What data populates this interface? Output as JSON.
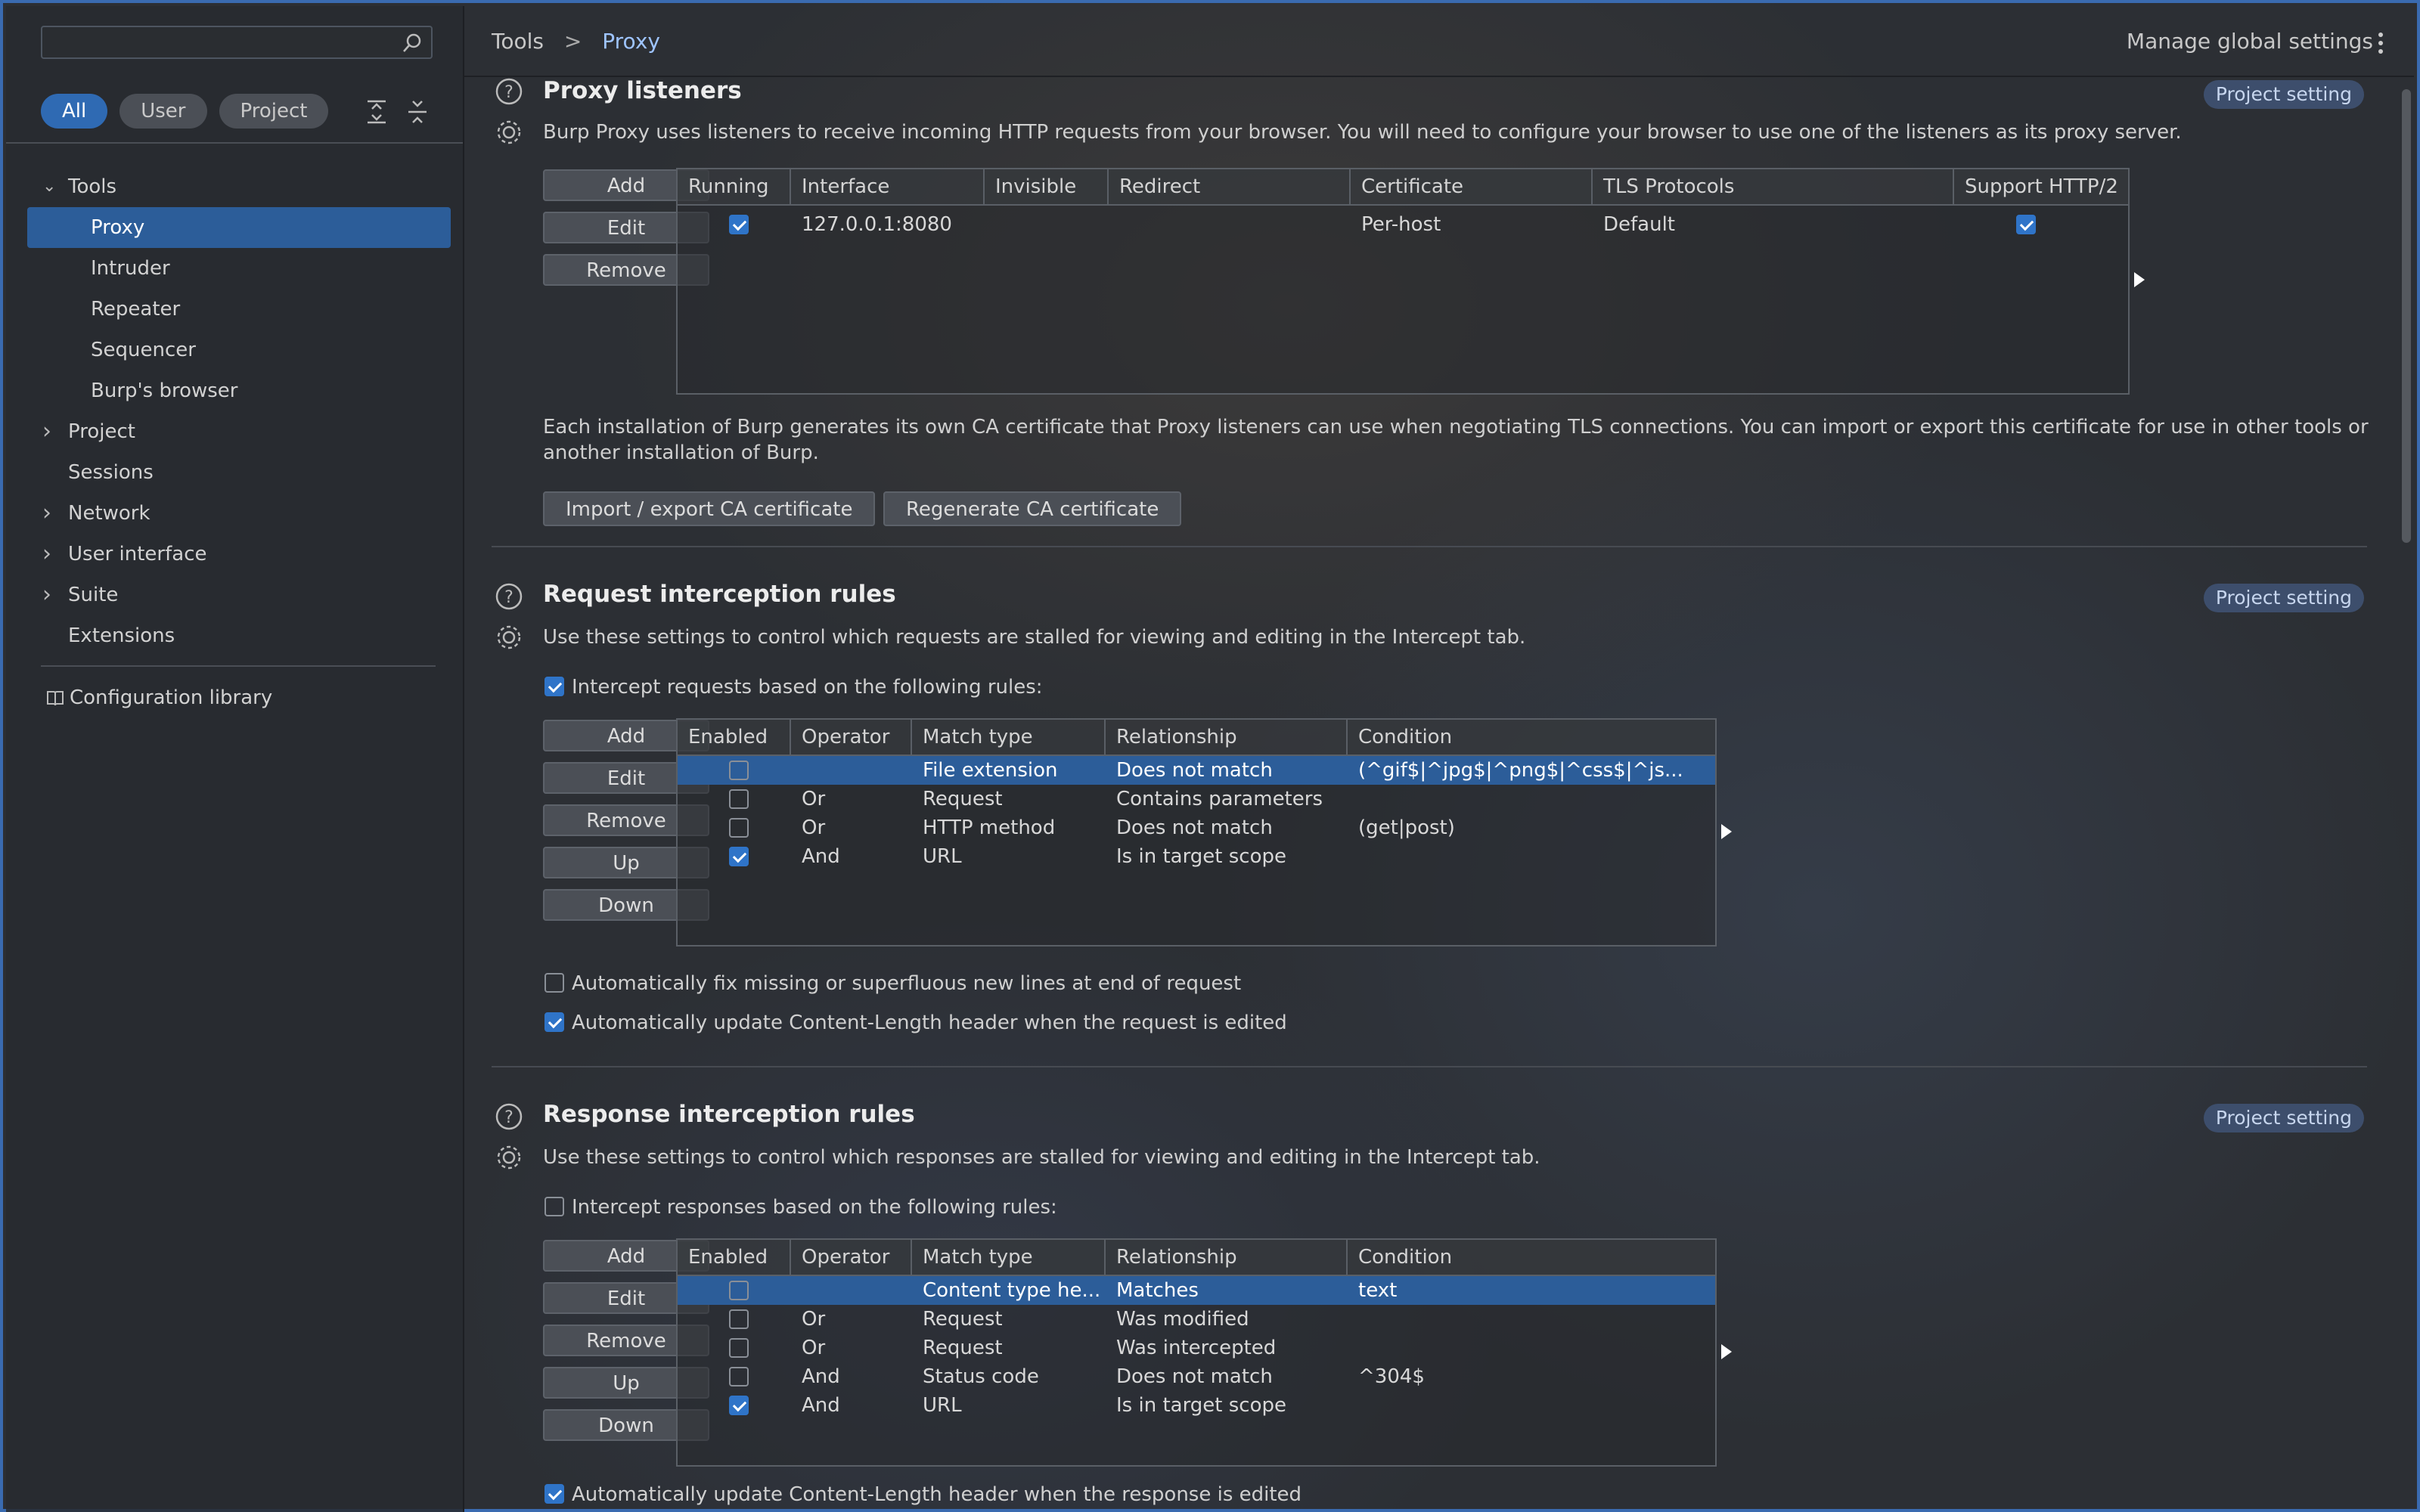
{
  "sidebar": {
    "search_placeholder": "",
    "filters": [
      "All",
      "User",
      "Project"
    ],
    "tree": [
      {
        "label": "Tools",
        "chevron": "v",
        "level": 0
      },
      {
        "label": "Proxy",
        "chevron": "",
        "level": 1,
        "selected": true
      },
      {
        "label": "Intruder",
        "chevron": "",
        "level": 1
      },
      {
        "label": "Repeater",
        "chevron": "",
        "level": 1
      },
      {
        "label": "Sequencer",
        "chevron": "",
        "level": 1
      },
      {
        "label": "Burp's browser",
        "chevron": "",
        "level": 1
      },
      {
        "label": "Project",
        "chevron": ">",
        "level": 0
      },
      {
        "label": "Sessions",
        "chevron": "",
        "level": 0
      },
      {
        "label": "Network",
        "chevron": ">",
        "level": 0
      },
      {
        "label": "User interface",
        "chevron": ">",
        "level": 0
      },
      {
        "label": "Suite",
        "chevron": ">",
        "level": 0
      },
      {
        "label": "Extensions",
        "chevron": "",
        "level": 0
      }
    ],
    "config_library": "Configuration library"
  },
  "header": {
    "breadcrumb_root": "Tools",
    "breadcrumb_sep": ">",
    "breadcrumb_current": "Proxy",
    "manage": "Manage global settings"
  },
  "listeners": {
    "title": "Proxy listeners",
    "badge": "Project setting",
    "desc": "Burp Proxy uses listeners to receive incoming HTTP requests from your browser. You will need to configure your browser to use one of the listeners as its proxy server.",
    "buttons": [
      "Add",
      "Edit",
      "Remove"
    ],
    "columns": [
      "Running",
      "Interface",
      "Invisible",
      "Redirect",
      "Certificate",
      "TLS Protocols",
      "Support HTTP/2"
    ],
    "rows": [
      {
        "running": true,
        "interface": "127.0.0.1:8080",
        "invisible": "",
        "redirect": "",
        "certificate": "Per-host",
        "tls": "Default",
        "http2": true
      }
    ],
    "ca_text_1": "Each installation of Burp generates its own CA certificate that Proxy listeners can use when negotiating TLS connections. You can import or export this certificate for use in other tools or",
    "ca_text_2": "another installation of Burp.",
    "ca_buttons": [
      "Import / export CA certificate",
      "Regenerate CA certificate"
    ]
  },
  "request_rules": {
    "title": "Request interception rules",
    "badge": "Project setting",
    "desc": "Use these settings to control which requests are stalled for viewing and editing in the Intercept tab.",
    "intercept_label": "Intercept requests based on the following rules:",
    "intercept_checked": true,
    "buttons": [
      "Add",
      "Edit",
      "Remove",
      "Up",
      "Down"
    ],
    "columns": [
      "Enabled",
      "Operator",
      "Match type",
      "Relationship",
      "Condition"
    ],
    "rows": [
      {
        "enabled": false,
        "operator": "",
        "match": "File extension",
        "rel": "Does not match",
        "cond": "(^gif$|^jpg$|^png$|^css$|^js...",
        "selected": true
      },
      {
        "enabled": false,
        "operator": "Or",
        "match": "Request",
        "rel": "Contains parameters",
        "cond": ""
      },
      {
        "enabled": false,
        "operator": "Or",
        "match": "HTTP method",
        "rel": "Does not match",
        "cond": "(get|post)"
      },
      {
        "enabled": true,
        "operator": "And",
        "match": "URL",
        "rel": "Is in target scope",
        "cond": ""
      }
    ],
    "opt1": "Automatically fix missing or superfluous new lines at end of request",
    "opt1_checked": false,
    "opt2": "Automatically update Content-Length header when the request is edited",
    "opt2_checked": true
  },
  "response_rules": {
    "title": "Response interception rules",
    "badge": "Project setting",
    "desc": "Use these settings to control which responses are stalled for viewing and editing in the Intercept tab.",
    "intercept_label": "Intercept responses based on the following rules:",
    "intercept_checked": false,
    "buttons": [
      "Add",
      "Edit",
      "Remove",
      "Up",
      "Down"
    ],
    "columns": [
      "Enabled",
      "Operator",
      "Match type",
      "Relationship",
      "Condition"
    ],
    "rows": [
      {
        "enabled": false,
        "operator": "",
        "match": "Content type he...",
        "rel": "Matches",
        "cond": "text",
        "selected": true
      },
      {
        "enabled": false,
        "operator": "Or",
        "match": "Request",
        "rel": "Was modified",
        "cond": ""
      },
      {
        "enabled": false,
        "operator": "Or",
        "match": "Request",
        "rel": "Was intercepted",
        "cond": ""
      },
      {
        "enabled": false,
        "operator": "And",
        "match": "Status code",
        "rel": "Does not match",
        "cond": "^304$"
      },
      {
        "enabled": true,
        "operator": "And",
        "match": "URL",
        "rel": "Is in target scope",
        "cond": ""
      }
    ],
    "opt1": "Automatically update Content-Length header when the response is edited",
    "opt1_checked": true
  },
  "colors": {
    "accent": "#2f6ab3",
    "selection": "#2c5d99",
    "badge": "#3d4e6c"
  }
}
